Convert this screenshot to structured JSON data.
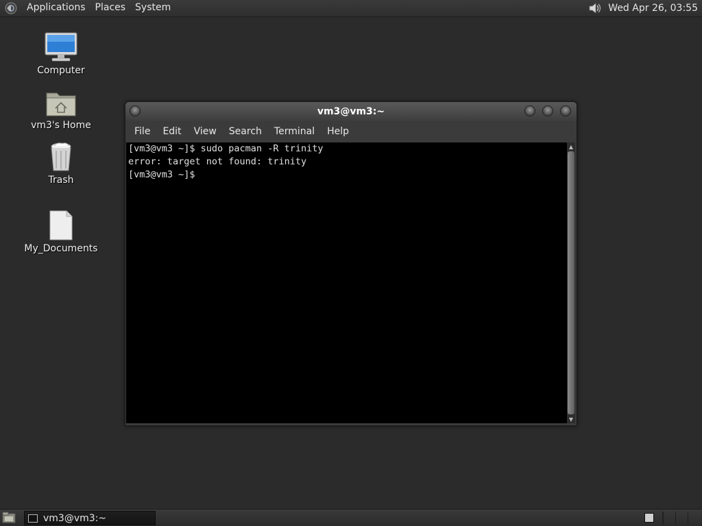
{
  "top_panel": {
    "menus": [
      "Applications",
      "Places",
      "System"
    ],
    "clock": "Wed Apr 26, 03:55"
  },
  "desktop": {
    "icons": [
      {
        "label": "Computer",
        "icon": "computer-icon"
      },
      {
        "label": "vm3's Home",
        "icon": "home-folder-icon"
      },
      {
        "label": "Trash",
        "icon": "trash-icon"
      },
      {
        "label": "My_Documents",
        "icon": "document-icon"
      }
    ]
  },
  "terminal": {
    "title": "vm3@vm3:~",
    "menu": [
      "File",
      "Edit",
      "View",
      "Search",
      "Terminal",
      "Help"
    ],
    "lines": [
      "[vm3@vm3 ~]$ sudo pacman -R trinity",
      "error: target not found: trinity",
      "[vm3@vm3 ~]$ "
    ]
  },
  "taskbar": {
    "tasks": [
      {
        "label": "vm3@vm3:~",
        "icon": "terminal-icon"
      }
    ]
  },
  "colors": {
    "desktop_bg": "#2b2b2b",
    "terminal_bg": "#000000",
    "terminal_fg": "#e0e0e0",
    "panel_bg": "#333333"
  }
}
